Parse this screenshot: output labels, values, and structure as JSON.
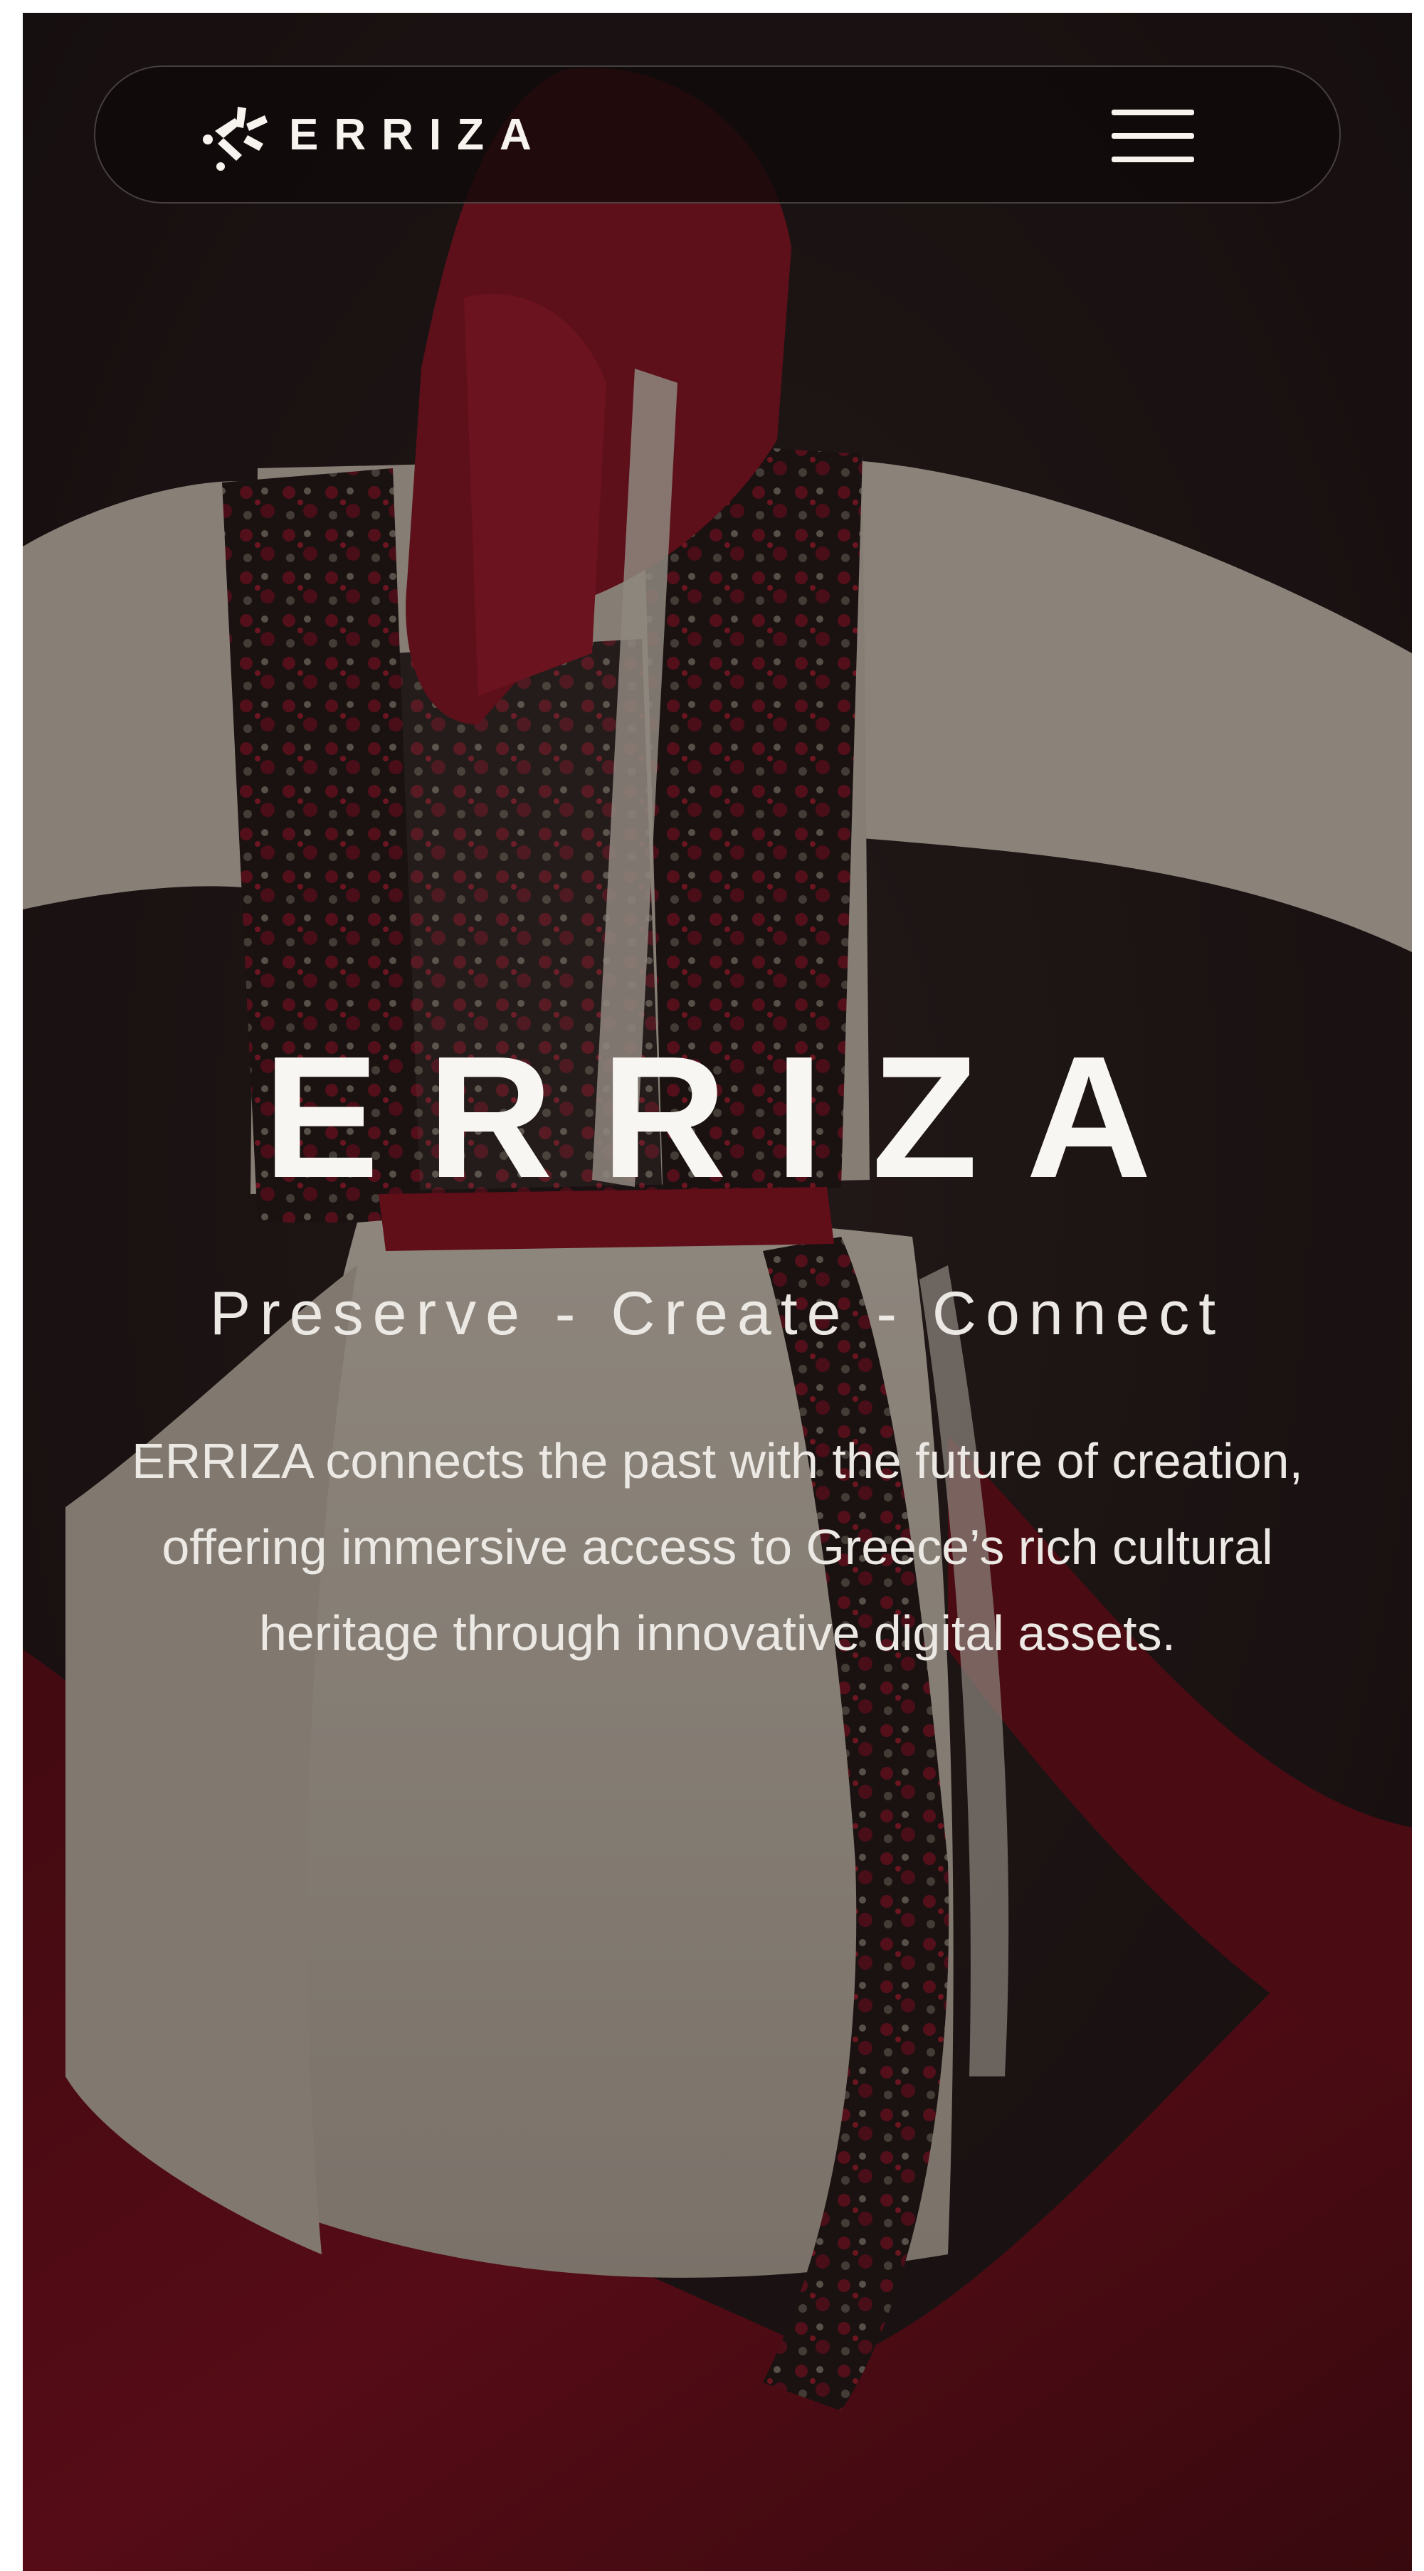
{
  "header": {
    "logo_icon": "erriza-star-logo-icon",
    "brand_name": "ERRIZA",
    "menu_icon": "hamburger-menu-icon"
  },
  "hero": {
    "background": "woman-in-traditional-greek-costume-photo",
    "title": "ERRIZA",
    "tagline": "Preserve - Create - Connect",
    "description": "ERRIZA connects the past with the future of creation, offering immersive access to Greece’s rich cultural heritage through innovative digital assets."
  },
  "colors": {
    "page_background": "#1e1616",
    "text": "#f8f6f2",
    "costume_red": "#8a0e1e",
    "costume_cream": "#ddd6c8",
    "nav_background": "#100909"
  }
}
